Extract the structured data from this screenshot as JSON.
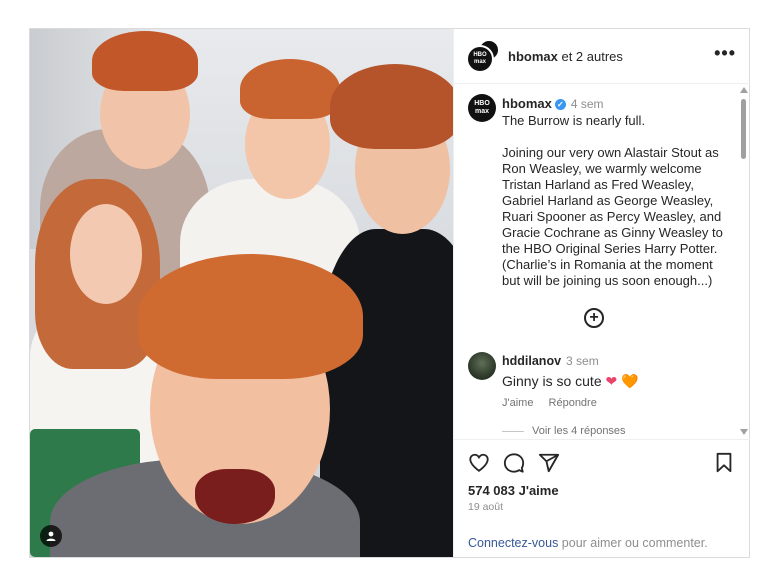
{
  "header": {
    "account": "hbomax",
    "coauthors": "et 2 autres",
    "logo_text": [
      "HBO",
      "max"
    ]
  },
  "caption": {
    "username": "hbomax",
    "time": "4 sem",
    "text": "The Burrow is nearly full.\n\nJoining our very own Alastair Stout as Ron Weasley, we warmly welcome Tristan Harland as Fred Weasley, Gabriel Harland as George Weasley, Ruari Spooner as Percy Weasley, and Gracie Cochrane as Ginny Weasley to the HBO Original Series Harry Potter. (Charlie’s in Romania at the moment but will be joining us soon enough...)"
  },
  "comment": {
    "username": "hddilanov",
    "time": "3 sem",
    "text": "Ginny is so cute",
    "emojis": [
      "❤",
      "🧡"
    ],
    "like_label": "J'aime",
    "reply_label": "Répondre",
    "view_replies": "Voir les 4 réponses"
  },
  "actions": {
    "likes_count": "574 083",
    "likes_label": "J'aime",
    "date": "19 août"
  },
  "login": {
    "link": "Connectez-vous",
    "rest": " pour aimer ou commenter."
  },
  "more_icon": "•••",
  "colors": {
    "accent": "#385898",
    "verified": "#3897f0",
    "muted": "#8e8e8e"
  }
}
